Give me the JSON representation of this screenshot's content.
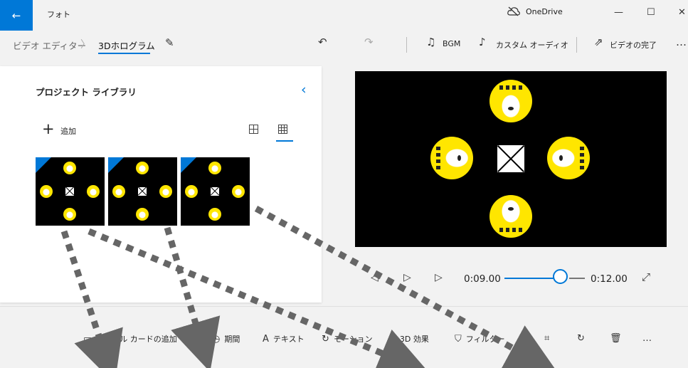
{
  "window": {
    "back_icon": "←",
    "title": "フォト",
    "onedrive_label": "OneDrive",
    "minimize": "—",
    "maximize": "☐",
    "close": "✕"
  },
  "toolbar": {
    "breadcrumb_root": "ビデオ エディター",
    "breadcrumb_sep": "〉",
    "breadcrumb_current": "3Dホログラム",
    "undo_icon": "↶",
    "redo_icon": "↷",
    "bgm_label": "BGM",
    "custom_audio_label": "カスタム オーディオ",
    "finish_video_label": "ビデオの完了",
    "more": "…"
  },
  "library": {
    "title": "プロジェクト ライブラリ",
    "collapse_icon": "‹",
    "add_label": "追加",
    "thumbnails": [
      {
        "name": "thumb-1"
      },
      {
        "name": "thumb-2"
      },
      {
        "name": "thumb-3"
      }
    ]
  },
  "playback": {
    "prev_icon": "◁",
    "play_icon": "▷",
    "next_icon": "▷",
    "current_time": "0:09.00",
    "end_time": "0:12.00",
    "progress": 0.75,
    "expand_icon": "⤢"
  },
  "bottom": {
    "title_card_label": "タイトル カードの追加",
    "duration_label": "期間",
    "text_label": "テキスト",
    "motion_label": "モーション",
    "effects_label": "3D 効果",
    "filter_label": "フィルター",
    "more": "…"
  },
  "colors": {
    "accent": "#0078d7",
    "panel": "#ffffff",
    "background": "#f2f2f2",
    "tiger_yellow": "#ffe600",
    "arrow_gray": "#666666"
  }
}
